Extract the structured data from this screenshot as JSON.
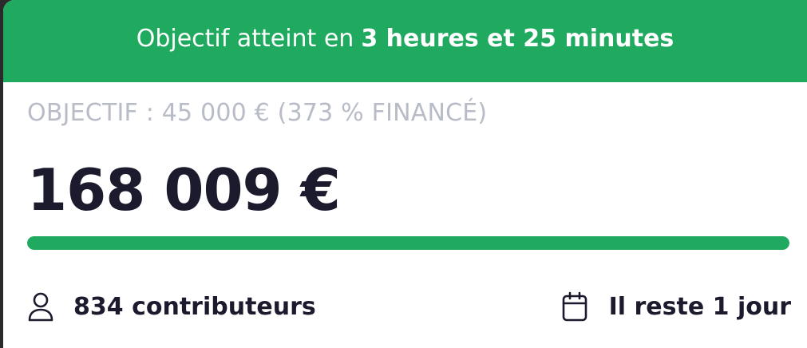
{
  "banner": {
    "prefix": "Objectif atteint en",
    "duration": "3 heures et 25 minutes"
  },
  "goal": {
    "label": "OBJECTIF : 45 000 € (373 % FINANCÉ)"
  },
  "raised": {
    "amount": "168 009 €"
  },
  "progress": {
    "fill_percent": 100
  },
  "stats": {
    "contributors": "834 contributeurs",
    "contributors_icon": "user-icon",
    "remaining": "Il reste 1 jour",
    "remaining_icon": "calendar-icon"
  },
  "colors": {
    "accent": "#1faa5f",
    "text_dark": "#1c1b2e",
    "text_muted": "#b7bcc7"
  }
}
